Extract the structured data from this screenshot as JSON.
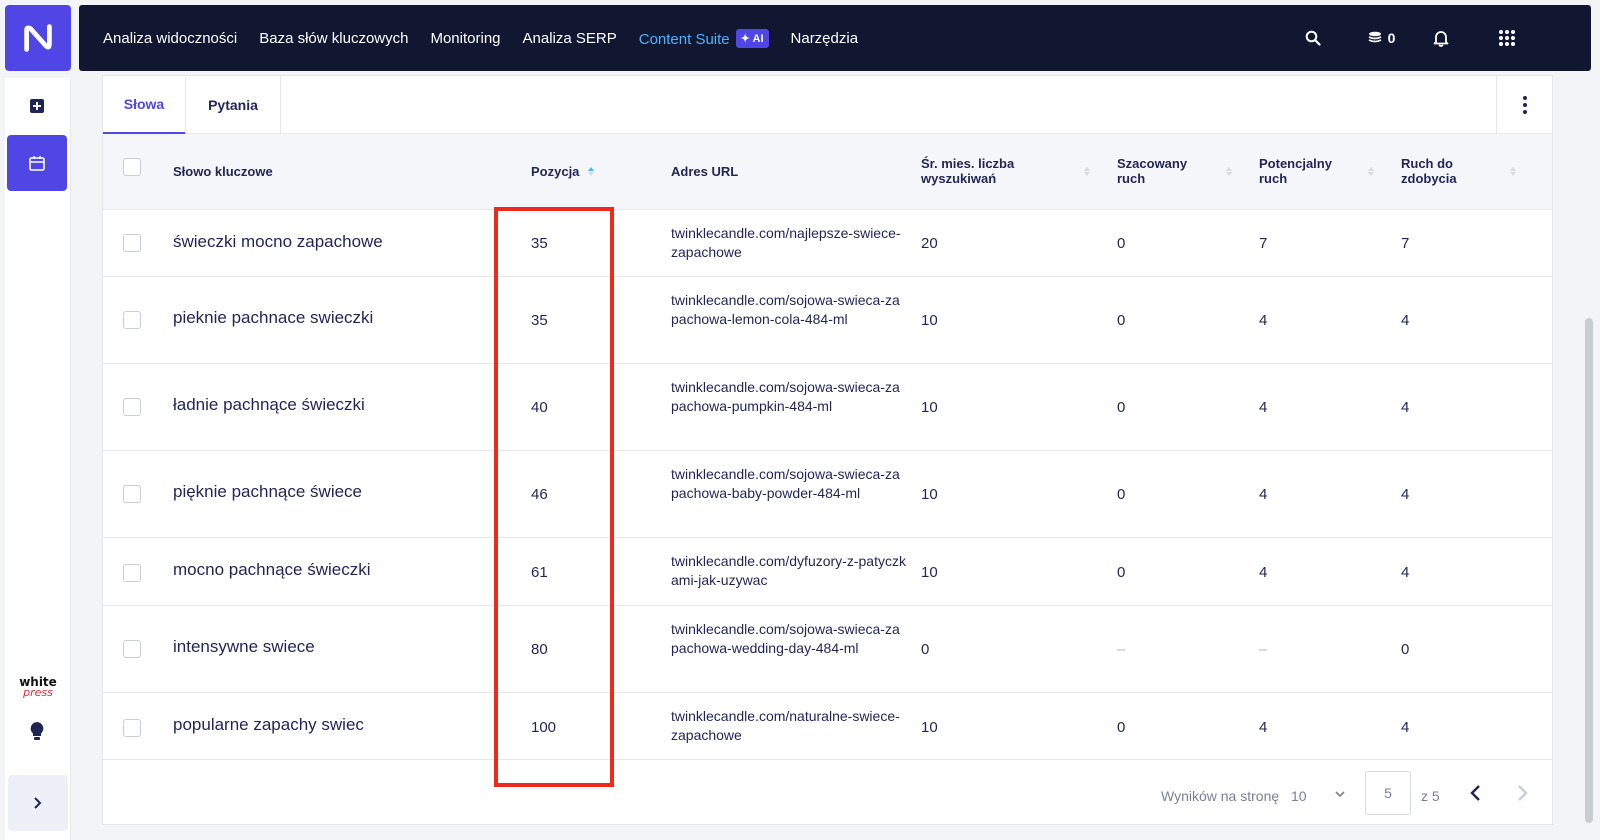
{
  "nav": {
    "items": [
      "Analiza widoczności",
      "Baza słów kluczowych",
      "Monitoring",
      "Analiza SERP",
      "Content Suite",
      "Narzędzia"
    ],
    "ai_badge": "✦ AI",
    "coins": "0"
  },
  "sidebar": {
    "brand_line1": "white",
    "brand_line2": "press"
  },
  "tabs": {
    "words": "Słowa",
    "questions": "Pytania"
  },
  "table": {
    "headers": {
      "keyword": "Słowo kluczowe",
      "position": "Pozycja",
      "url": "Adres URL",
      "avg_searches": "Śr. mies. liczba wyszukiwań",
      "est_traffic": "Szacowany ruch",
      "potential": "Potencjalny ruch",
      "to_gain": "Ruch do zdobycia"
    },
    "rows": [
      {
        "keyword": "świeczki mocno zapachowe",
        "position": "35",
        "url": "twinklecandle.com/najlepsze-swiece-zapachowe",
        "searches": "20",
        "est": "0",
        "potential": "7",
        "gain": "7"
      },
      {
        "keyword": "pieknie pachnace swieczki",
        "position": "35",
        "url": "twinklecandle.com/sojowa-swieca-zapachowa-lemon-cola-484-ml",
        "searches": "10",
        "est": "0",
        "potential": "4",
        "gain": "4"
      },
      {
        "keyword": "ładnie pachnące świeczki",
        "position": "40",
        "url": "twinklecandle.com/sojowa-swieca-zapachowa-pumpkin-484-ml",
        "searches": "10",
        "est": "0",
        "potential": "4",
        "gain": "4"
      },
      {
        "keyword": "pięknie pachnące świece",
        "position": "46",
        "url": "twinklecandle.com/sojowa-swieca-zapachowa-baby-powder-484-ml",
        "searches": "10",
        "est": "0",
        "potential": "4",
        "gain": "4"
      },
      {
        "keyword": "mocno pachnące świeczki",
        "position": "61",
        "url": "twinklecandle.com/dyfuzory-z-patyczkami-jak-uzywac",
        "searches": "10",
        "est": "0",
        "potential": "4",
        "gain": "4"
      },
      {
        "keyword": "intensywne swiece",
        "position": "80",
        "url": "twinklecandle.com/sojowa-swieca-zapachowa-wedding-day-484-ml",
        "searches": "0",
        "est": "–",
        "potential": "–",
        "gain": "0"
      },
      {
        "keyword": "popularne zapachy swiec",
        "position": "100",
        "url": "twinklecandle.com/naturalne-swiece-zapachowe",
        "searches": "10",
        "est": "0",
        "potential": "4",
        "gain": "4"
      }
    ]
  },
  "pagination": {
    "per_page_label": "Wyników na stronę",
    "per_page_value": "10",
    "current_page": "5",
    "total_pages_label": "z 5"
  },
  "colors": {
    "accent": "#4f46e5",
    "nav_bg": "#111631",
    "highlight_link": "#4fb2ff",
    "annotation_red": "#ee2a1b"
  }
}
